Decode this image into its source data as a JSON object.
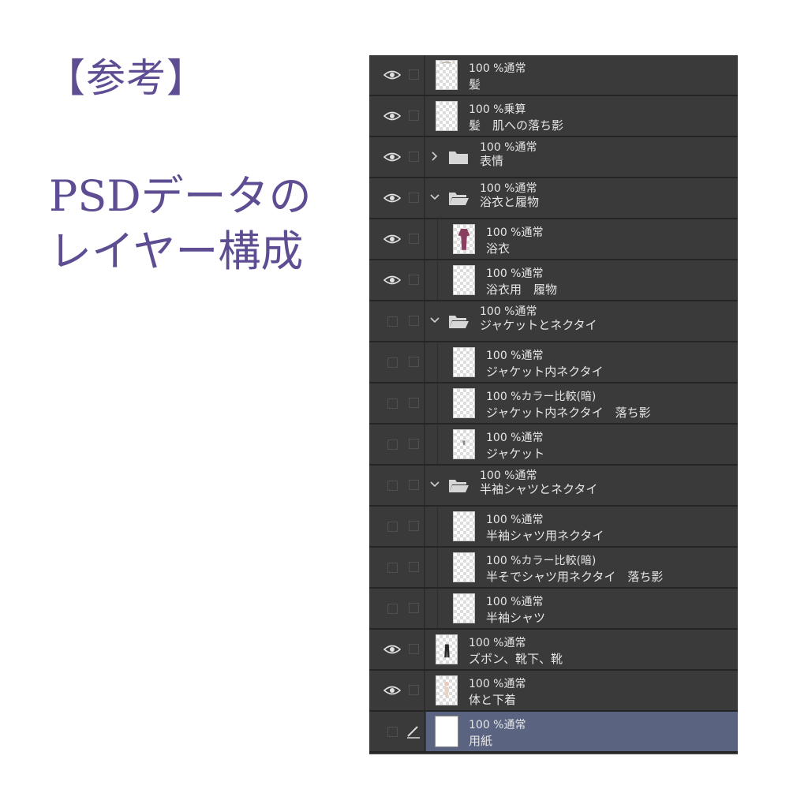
{
  "heading": {
    "ref": "【参考】",
    "title_line1": "PSDデータの",
    "title_line2": "レイヤー構成"
  },
  "colors": {
    "heading": "#5e4d92",
    "panel_bg": "#3a3a3a",
    "selected_row": "#5a6480"
  },
  "layers": [
    {
      "opacity_mode": "100 %通常",
      "name": "髪",
      "visible": true,
      "indent": 0,
      "thumb": "hair"
    },
    {
      "opacity_mode": "100 %乗算",
      "name": "髪　肌への落ち影",
      "visible": true,
      "indent": 0,
      "thumb": "blank"
    },
    {
      "opacity_mode": "100 %通常",
      "name": "表情",
      "visible": true,
      "indent": 0,
      "thumb": "folder-closed"
    },
    {
      "opacity_mode": "100 %通常",
      "name": "浴衣と履物",
      "visible": true,
      "indent": 0,
      "thumb": "folder-open"
    },
    {
      "opacity_mode": "100 %通常",
      "name": "浴衣",
      "visible": true,
      "indent": 1,
      "thumb": "yukata"
    },
    {
      "opacity_mode": "100 %通常",
      "name": "浴衣用　履物",
      "visible": true,
      "indent": 1,
      "thumb": "blank"
    },
    {
      "opacity_mode": "100 %通常",
      "name": "ジャケットとネクタイ",
      "visible": false,
      "indent": 0,
      "thumb": "folder-open"
    },
    {
      "opacity_mode": "100 %通常",
      "name": "ジャケット内ネクタイ",
      "visible": false,
      "indent": 1,
      "thumb": "blank"
    },
    {
      "opacity_mode": "100 %カラー比較(暗)",
      "name": "ジャケット内ネクタイ　落ち影",
      "visible": false,
      "indent": 1,
      "thumb": "blank"
    },
    {
      "opacity_mode": "100 %通常",
      "name": "ジャケット",
      "visible": false,
      "indent": 1,
      "thumb": "jacket"
    },
    {
      "opacity_mode": "100 %通常",
      "name": "半袖シャツとネクタイ",
      "visible": false,
      "indent": 0,
      "thumb": "folder-open"
    },
    {
      "opacity_mode": "100 %通常",
      "name": "半袖シャツ用ネクタイ",
      "visible": false,
      "indent": 1,
      "thumb": "blank"
    },
    {
      "opacity_mode": "100 %カラー比較(暗)",
      "name": "半そでシャツ用ネクタイ　落ち影",
      "visible": false,
      "indent": 1,
      "thumb": "blank"
    },
    {
      "opacity_mode": "100 %通常",
      "name": "半袖シャツ",
      "visible": false,
      "indent": 1,
      "thumb": "blank"
    },
    {
      "opacity_mode": "100 %通常",
      "name": "ズボン、靴下、靴",
      "visible": true,
      "indent": 0,
      "thumb": "pants"
    },
    {
      "opacity_mode": "100 %通常",
      "name": "体と下着",
      "visible": true,
      "indent": 0,
      "thumb": "body"
    },
    {
      "opacity_mode": "100 %通常",
      "name": "用紙",
      "visible": false,
      "indent": 0,
      "thumb": "paper",
      "selected": true
    }
  ]
}
